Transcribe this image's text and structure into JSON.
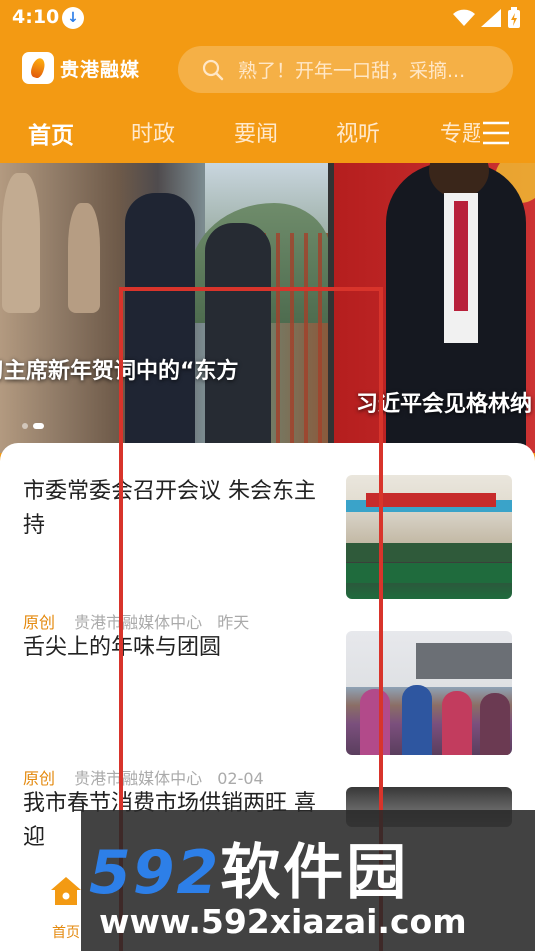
{
  "status_bar": {
    "time": "4:10",
    "download_indicator": "download-icon",
    "system_icons": [
      "wifi-icon",
      "signal-icon",
      "battery-charging-icon"
    ]
  },
  "header": {
    "app_name": "贵港融媒",
    "search_placeholder": "熟了！开年一口甜，采摘...",
    "accent_color": "#f39a13"
  },
  "tabs": [
    {
      "label": "首页",
      "active": true
    },
    {
      "label": "时政",
      "active": false
    },
    {
      "label": "要闻",
      "active": false
    },
    {
      "label": "视听",
      "active": false
    },
    {
      "label": "专题",
      "active": false
    }
  ],
  "carousel": {
    "slides": [
      {
        "caption": "习主席新年贺词中的“东方"
      },
      {
        "caption": "习近平会见格林纳"
      }
    ],
    "active_index": 1
  },
  "news": [
    {
      "title": "市委常委会召开会议 朱会东主持",
      "tag": "原创",
      "source": "贵港市融媒体中心",
      "date": "昨天"
    },
    {
      "title": "舌尖上的年味与团圆",
      "tag": "原创",
      "source": "贵港市融媒体中心",
      "date": "02-04"
    },
    {
      "title": "我市春节消费市场供销两旺 喜迎"
    }
  ],
  "bottom_nav": {
    "home_label": "首页"
  },
  "watermark": {
    "brand_digits": "592",
    "brand_cn": "软件园",
    "url": "www.592xiazai.com"
  }
}
